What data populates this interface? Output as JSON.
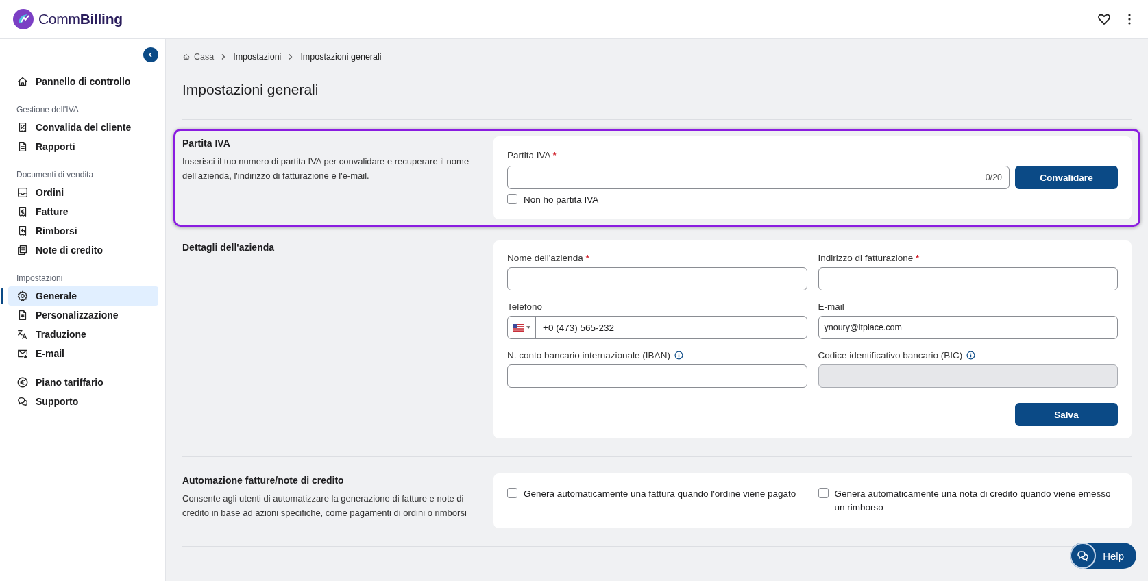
{
  "header": {
    "brand": "Comm**Billing**"
  },
  "sidebar": {
    "groups": [
      {
        "items": [
          {
            "label": "Pannello di controllo",
            "selected": false
          }
        ]
      },
      {
        "heading": "Gestione dell'IVA",
        "items": [
          {
            "label": "Convalida del cliente",
            "selected": false
          },
          {
            "label": "Rapporti",
            "selected": false
          }
        ]
      },
      {
        "heading": "Documenti di vendita",
        "items": [
          {
            "label": "Ordini",
            "selected": false
          },
          {
            "label": "Fatture",
            "selected": false
          },
          {
            "label": "Rimborsi",
            "selected": false
          },
          {
            "label": "Note di credito",
            "selected": false
          }
        ]
      },
      {
        "heading": "Impostazioni",
        "items": [
          {
            "label": "Generale",
            "selected": true
          },
          {
            "label": "Personalizzazione",
            "selected": false
          },
          {
            "label": "Traduzione",
            "selected": false
          },
          {
            "label": "E-mail",
            "selected": false
          }
        ]
      },
      {
        "items": [
          {
            "label": "Piano tariffario",
            "selected": false
          },
          {
            "label": "Supporto",
            "selected": false
          }
        ]
      }
    ]
  },
  "breadcrumb": [
    "Casa",
    "Impostazioni",
    "Impostazioni generali"
  ],
  "page_title": "Impostazioni generali",
  "vat_section": {
    "title": "Partita IVA",
    "description": "Inserisci il tuo numero di partita IVA per convalidare e recuperare il nome dell'azienda, l'indirizzo di fatturazione e l'e-mail.",
    "highlighted": true,
    "field": {
      "label": "Partita IVA",
      "required_mark": "*",
      "counter": "0/20"
    },
    "button": "Convalidare",
    "checkbox": {
      "label": "Non ho partita IVA",
      "checked": false
    }
  },
  "company_section": {
    "title": "Dettagli dell'azienda",
    "fields": [
      {
        "kind": "text",
        "label": "Nome dell'azienda",
        "required_mark": "*"
      },
      {
        "kind": "text",
        "label": "Indirizzo di fatturazione",
        "required_mark": "*"
      },
      {
        "kind": "phone",
        "label": "Telefono",
        "value": "+0 (473) 565-232"
      },
      {
        "kind": "text",
        "label": "E-mail",
        "value": "ynoury@itplace.com"
      },
      {
        "kind": "text",
        "label": "N. conto bancario internazionale (IBAN)",
        "info": true
      },
      {
        "kind": "text",
        "label": "Codice identificativo bancario (BIC)",
        "info": true,
        "disabled": true
      }
    ],
    "button": "Salva"
  },
  "automation_section": {
    "title": "Automazione fatture/note di credito",
    "description": "Consente agli utenti di automatizzare la generazione di fatture e note di credito in base ad azioni specifiche, come pagamenti di ordini o rimborsi",
    "options": [
      {
        "label": "Genera automaticamente una fattura quando l'ordine viene pagato",
        "checked": false
      },
      {
        "label": "Genera automaticamente una nota di credito quando viene emesso un rimborso",
        "checked": false
      }
    ]
  },
  "help": {
    "label": "Help"
  }
}
